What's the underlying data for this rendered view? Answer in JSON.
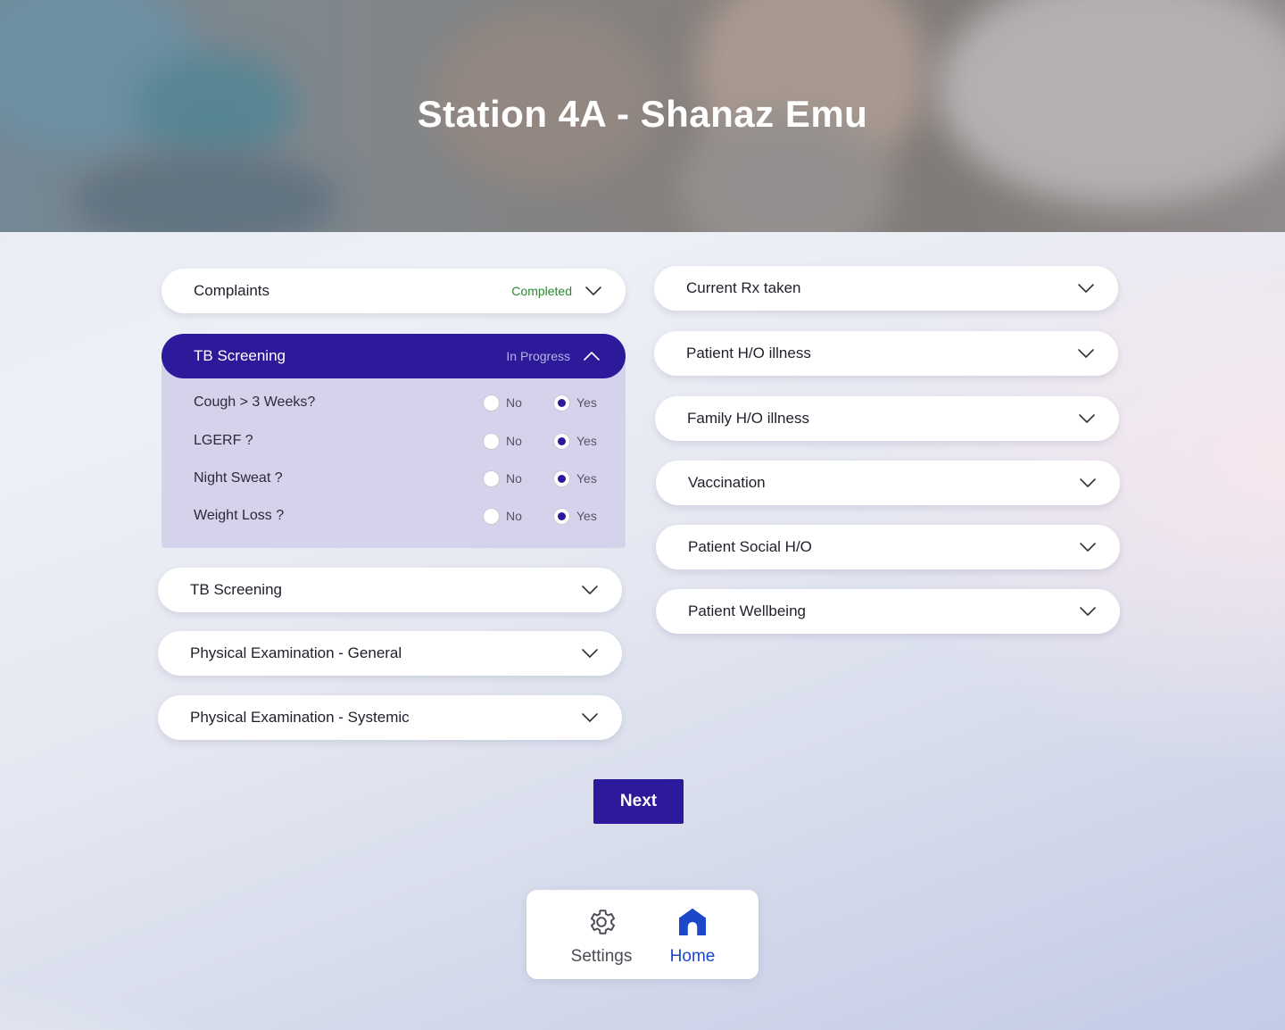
{
  "header": {
    "title": "Station 4A - Shanaz Emu"
  },
  "left_sections": {
    "complaints": {
      "label": "Complaints",
      "status": "Completed"
    },
    "tb_screening_open": {
      "label": "TB Screening",
      "status": "In Progress",
      "questions": [
        {
          "question": "Cough > 3 Weeks?",
          "no": "No",
          "yes": "Yes",
          "selected": "Yes"
        },
        {
          "question": "LGERF ?",
          "no": "No",
          "yes": "Yes",
          "selected": "Yes"
        },
        {
          "question": "Night Sweat ?",
          "no": "No",
          "yes": "Yes",
          "selected": "Yes"
        },
        {
          "question": "Weight Loss ?",
          "no": "No",
          "yes": "Yes",
          "selected": "Yes"
        }
      ]
    },
    "tb_screening": {
      "label": "TB Screening"
    },
    "physical_general": {
      "label": "Physical Examination - General"
    },
    "physical_systemic": {
      "label": "Physical Examination - Systemic"
    }
  },
  "right_sections": [
    {
      "label": "Current Rx taken"
    },
    {
      "label": "Patient H/O illness"
    },
    {
      "label": "Family H/O illness"
    },
    {
      "label": "Vaccination"
    },
    {
      "label": "Patient Social H/O"
    },
    {
      "label": "Patient Wellbeing"
    }
  ],
  "actions": {
    "next_label": "Next"
  },
  "bottom_nav": {
    "settings": {
      "label": "Settings",
      "icon": "gear-icon"
    },
    "home": {
      "label": "Home",
      "icon": "home-icon",
      "active": true
    }
  },
  "colors": {
    "primary": "#2c1a9a",
    "completed": "#2a8a2e",
    "nav_active": "#1b47c8"
  }
}
